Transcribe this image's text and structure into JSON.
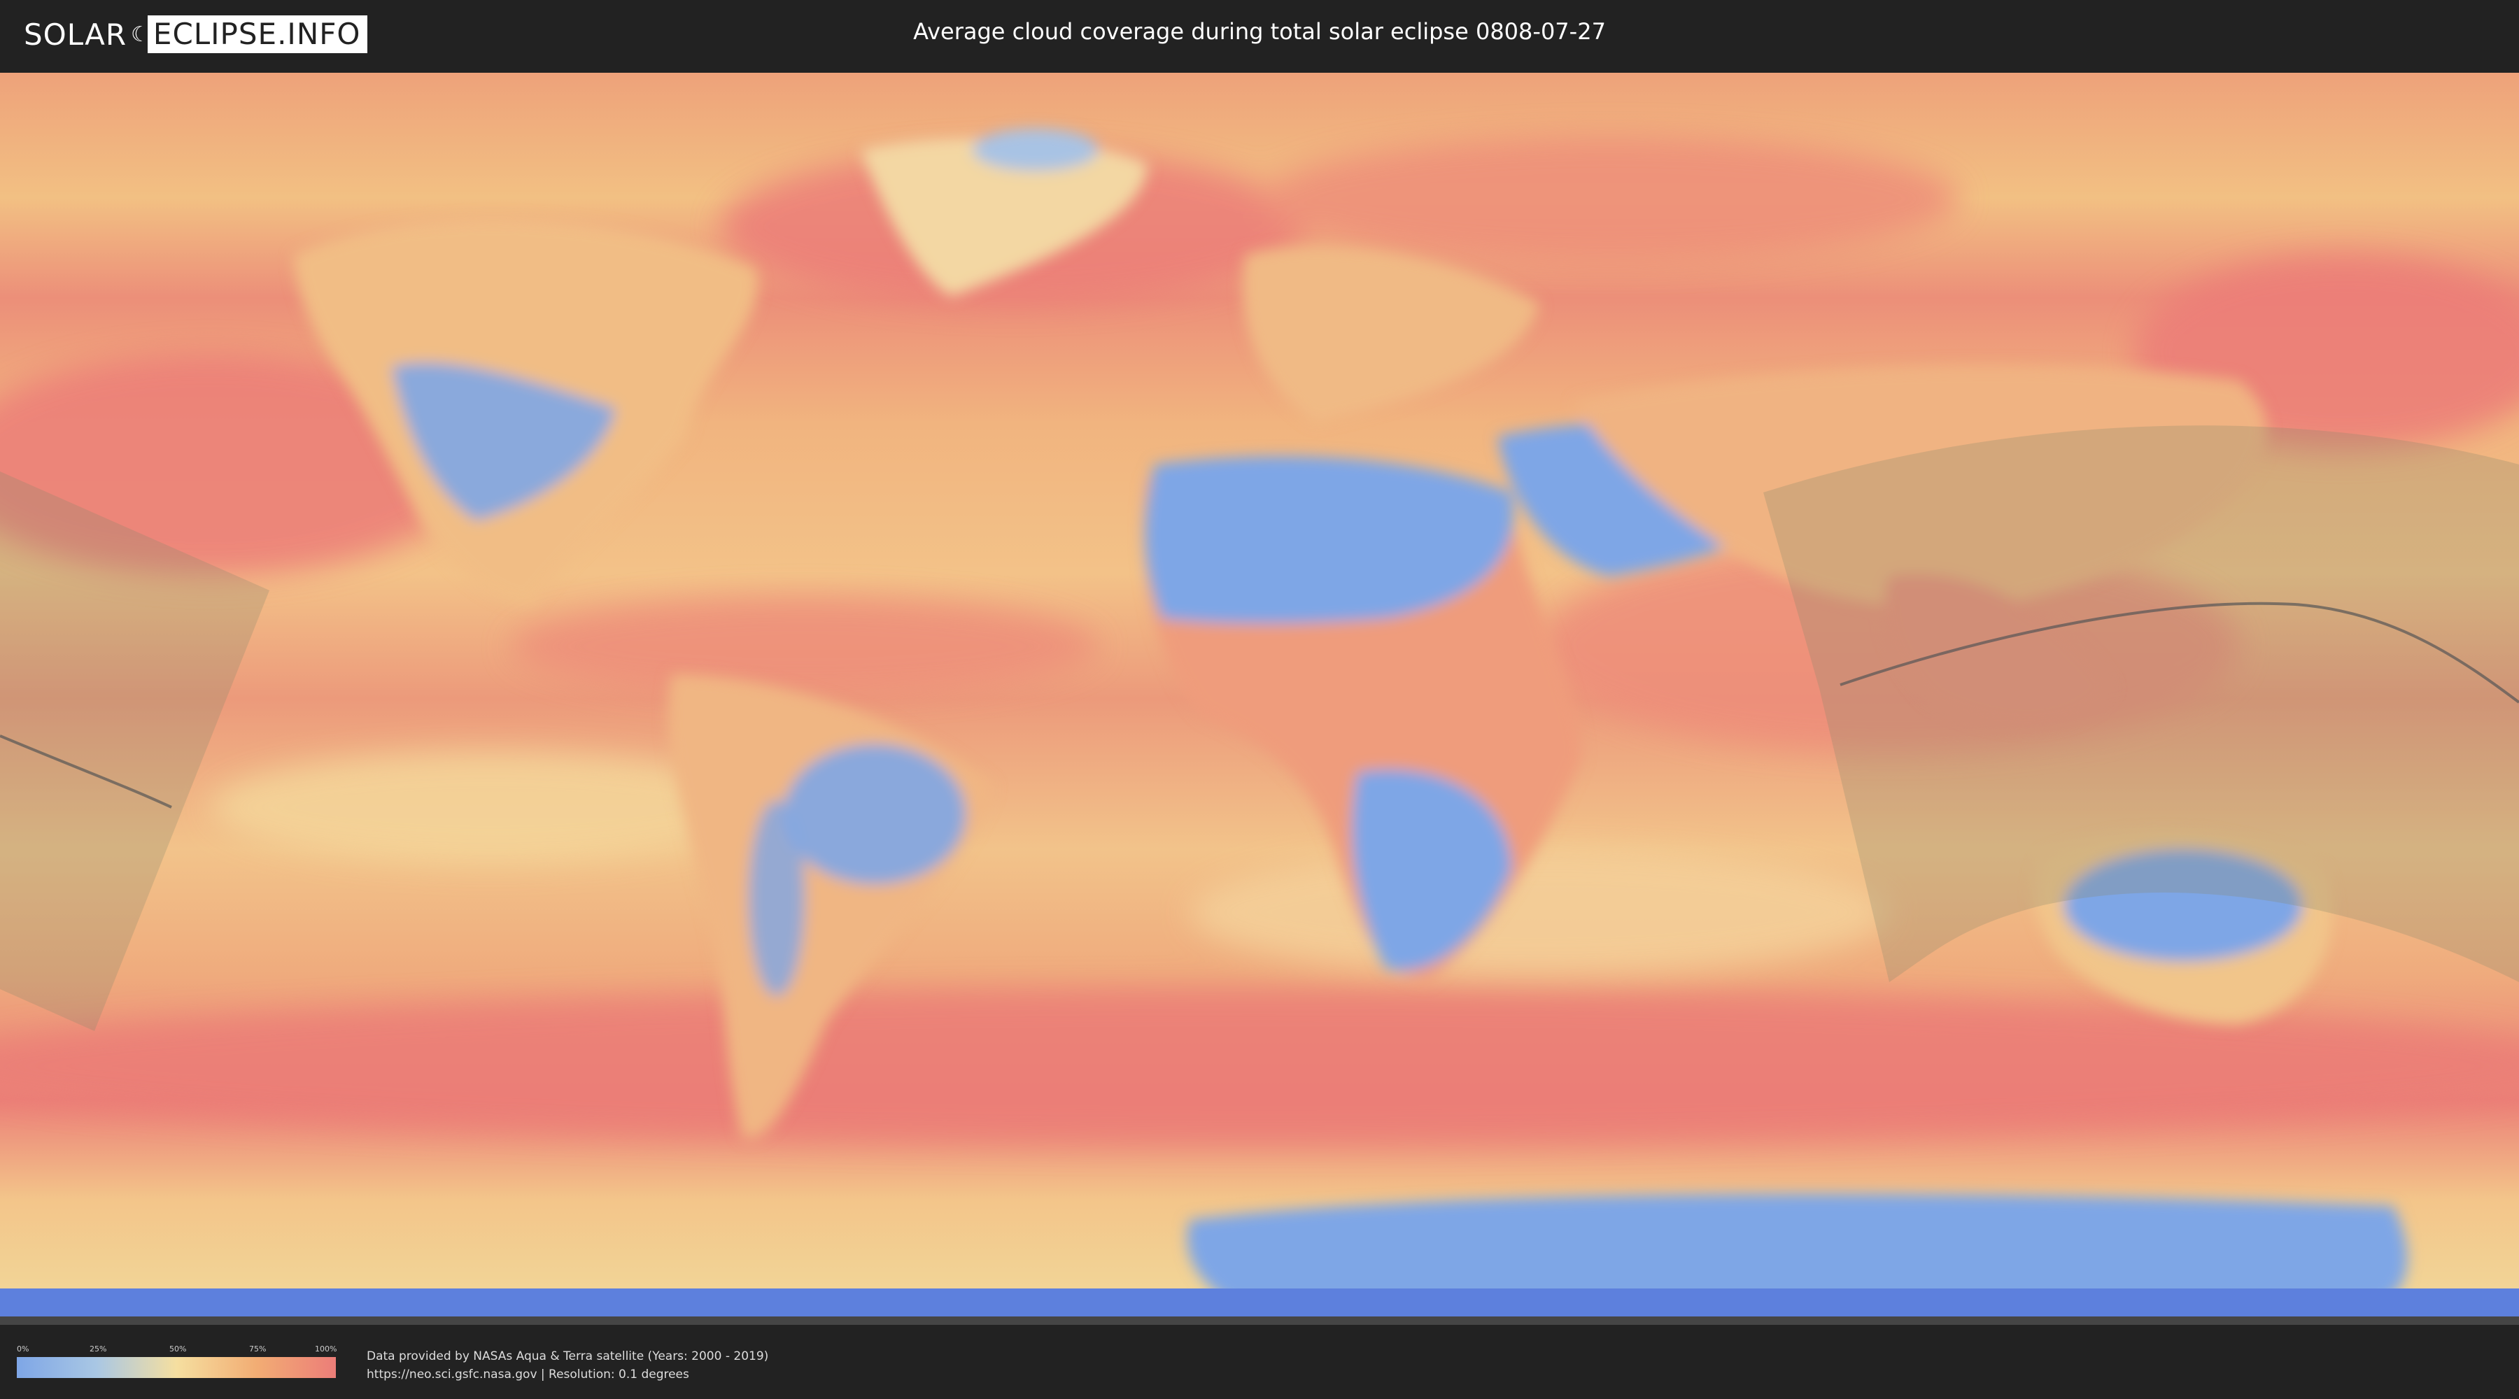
{
  "header": {
    "logo_left": "SOLAR",
    "logo_right": "ECLIPSE.INFO",
    "title": "Average cloud coverage during total solar eclipse 0808-07-27"
  },
  "legend": {
    "ticks": [
      "0%",
      "25%",
      "50%",
      "75%",
      "100%"
    ],
    "colors": [
      "#7ea6e6",
      "#a9c7e4",
      "#f5dfa0",
      "#f2ad74",
      "#ec7d78"
    ]
  },
  "attribution": {
    "line1": "Data provided by NASAs Aqua & Terra satellite (Years: 2000 - 2019)",
    "line2": "https://neo.sci.gsfc.nasa.gov | Resolution: 0.1 degrees"
  },
  "map": {
    "ocean_color": "#e9a77a",
    "cloudy_color": "#ec7d78",
    "clear_color": "#7ea6e6",
    "shadow_color": "#8a8a6a",
    "path_line_color": "#555555"
  }
}
